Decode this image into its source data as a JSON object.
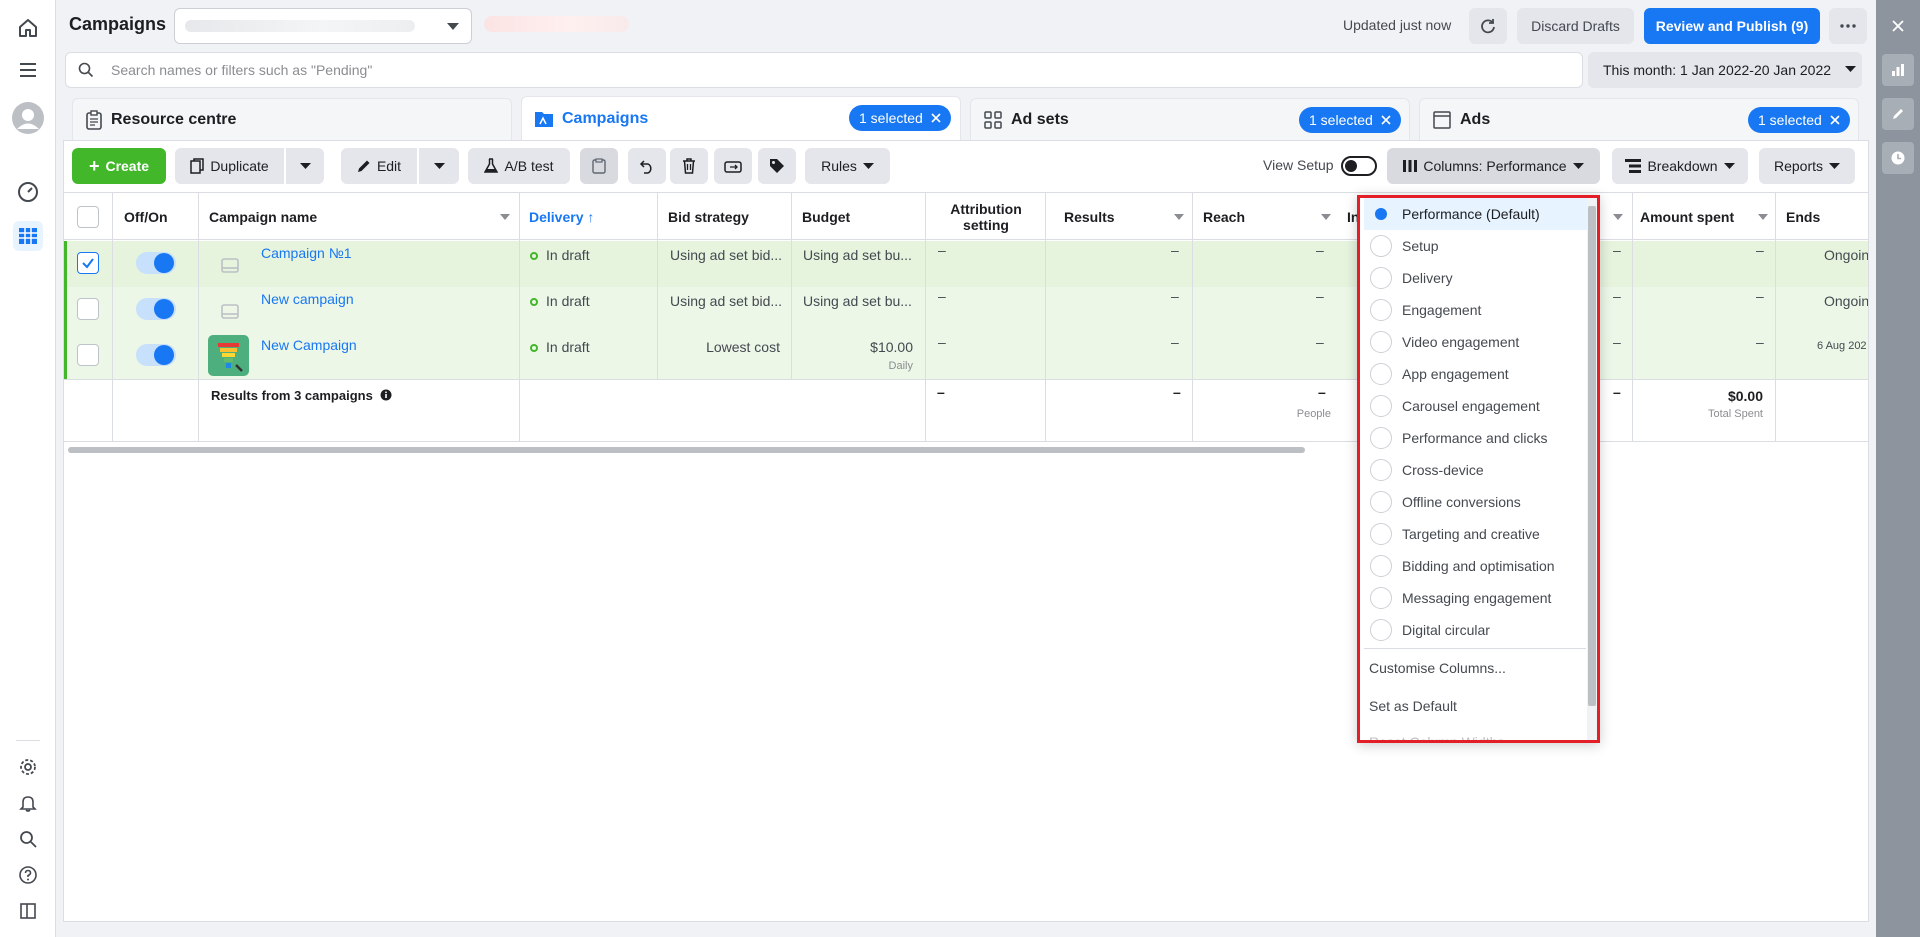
{
  "header": {
    "title": "Campaigns",
    "updated": "Updated just now",
    "discard": "Discard Drafts",
    "publish": "Review and Publish (9)"
  },
  "search": {
    "placeholder": "Search names or filters such as \"Pending\""
  },
  "date_range": "This month: 1 Jan 2022-20 Jan 2022",
  "tabs": [
    {
      "label": "Resource centre"
    },
    {
      "label": "Campaigns",
      "selected": "1 selected"
    },
    {
      "label": "Ad sets",
      "selected": "1 selected"
    },
    {
      "label": "Ads",
      "selected": "1 selected"
    }
  ],
  "toolbar": {
    "create": "Create",
    "duplicate": "Duplicate",
    "edit": "Edit",
    "abtest": "A/B test",
    "rules": "Rules",
    "view_setup": "View Setup",
    "columns": "Columns: Performance",
    "breakdown": "Breakdown",
    "reports": "Reports"
  },
  "table": {
    "headers": {
      "offon": "Off/On",
      "name": "Campaign name",
      "delivery": "Delivery",
      "bid": "Bid strategy",
      "budget": "Budget",
      "attribution": "Attribution setting",
      "results": "Results",
      "reach": "Reach",
      "impr_partial": "In",
      "amount": "Amount spent",
      "ends": "Ends"
    },
    "rows": [
      {
        "name": "Campaign №1",
        "delivery": "In draft",
        "bid": "Using ad set bid...",
        "budget": "Using ad set bu...",
        "ends": "Ongoin"
      },
      {
        "name": "New campaign",
        "delivery": "In draft",
        "bid": "Using ad set bid...",
        "budget": "Using ad set bu...",
        "ends": "Ongoin"
      },
      {
        "name": "New Campaign",
        "delivery": "In draft",
        "bid": "Lowest cost",
        "budget": "$10.00",
        "budget_sub": "Daily",
        "ends": "6 Aug 202"
      }
    ],
    "dash": "–",
    "summary": {
      "label": "Results from 3 campaigns",
      "reach_sub": "People",
      "amount": "$0.00",
      "amount_sub": "Total Spent"
    }
  },
  "columns_menu": {
    "items": [
      "Performance (Default)",
      "Setup",
      "Delivery",
      "Engagement",
      "Video engagement",
      "App engagement",
      "Carousel engagement",
      "Performance and clicks",
      "Cross-device",
      "Offline conversions",
      "Targeting and creative",
      "Bidding and optimisation",
      "Messaging engagement",
      "Digital circular"
    ],
    "customise": "Customise Columns...",
    "set_default": "Set as Default",
    "reset_partial": "Reset Column Widths"
  }
}
